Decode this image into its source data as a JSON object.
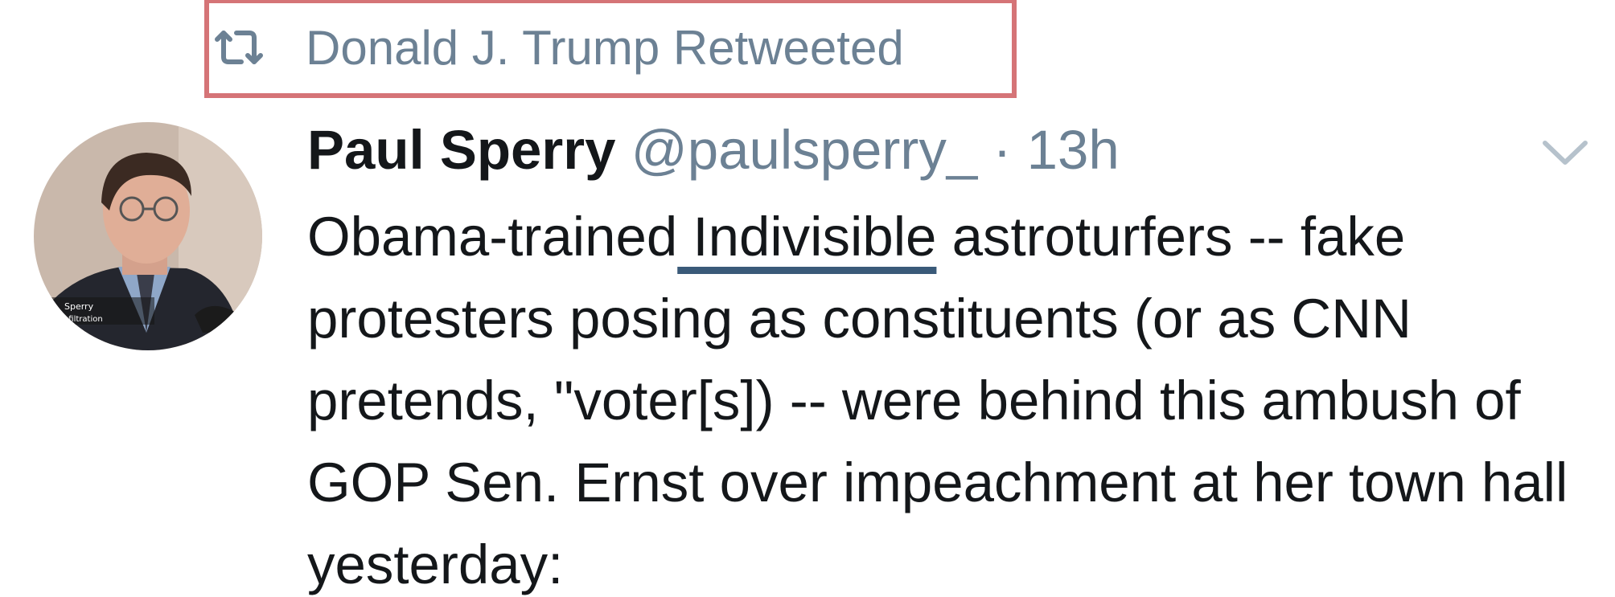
{
  "retweet": {
    "icon": "retweet-icon",
    "label": "Donald J. Trump Retweeted",
    "highlight_color": "#d57477"
  },
  "tweet": {
    "avatar_caption": {
      "line1": "Sperry",
      "line2": "Infiltration"
    },
    "display_name": "Paul Sperry",
    "handle": "@paulsperry_",
    "separator": "·",
    "time": "13h",
    "menu_icon": "chevron-down-icon",
    "text": {
      "part1": "Obama-trained",
      "link": " Indivisible",
      "part2": " astroturfers -- fake protesters posing as constituents (or as CNN pretends, \"voter[s]) -- were behind this ambush of GOP Sen. Ernst over impeachment at her town hall yesterday:"
    }
  },
  "colors": {
    "text_primary": "#14171a",
    "text_secondary": "#6c8194",
    "link_underline": "#3a5a79"
  }
}
